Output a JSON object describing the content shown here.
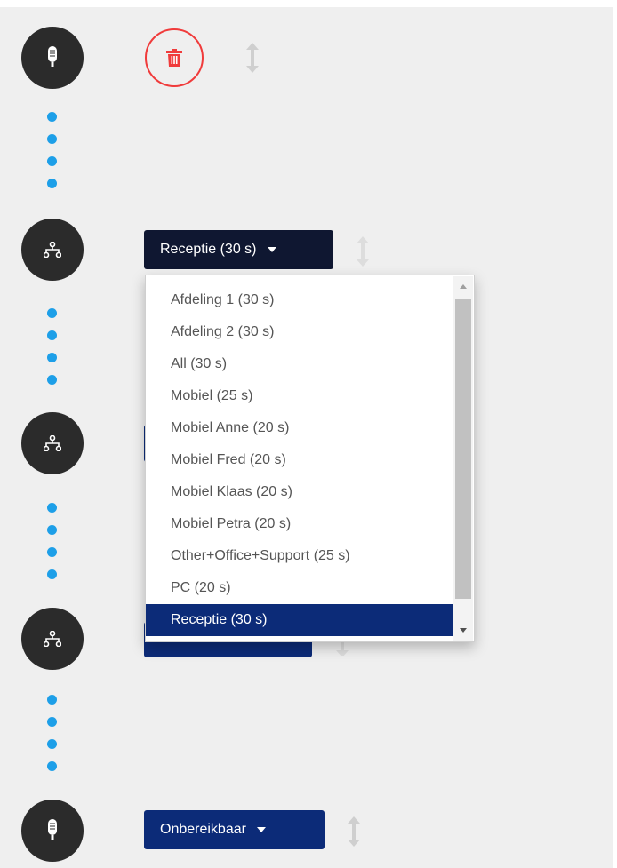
{
  "flow": {
    "dropdown_button_label": "Receptie (30 s)",
    "bottom_button_label": "Onbereikbaar",
    "dropdown_options": [
      "Afdeling 1 (30 s)",
      "Afdeling 2 (30 s)",
      "All (30 s)",
      "Mobiel (25 s)",
      "Mobiel Anne (20 s)",
      "Mobiel Fred (20 s)",
      "Mobiel Klaas (20 s)",
      "Mobiel Petra (20 s)",
      "Other+Office+Support (25 s)",
      "PC (20 s)",
      "Receptie (30 s)"
    ],
    "selected_option": "Receptie (30 s)"
  },
  "colors": {
    "node": "#2b2b2b",
    "connector_dot": "#1d9fe8",
    "delete": "#f03b3b",
    "button_dark": "#0f1731",
    "button_blue": "#0c2b78",
    "selected_option_bg": "#0c2b78"
  },
  "icons": {
    "microphone": "microphone-icon",
    "hierarchy": "hierarchy-icon",
    "trash": "trash-icon",
    "drag": "drag-vertical-icon",
    "caret": "caret-down-icon"
  }
}
